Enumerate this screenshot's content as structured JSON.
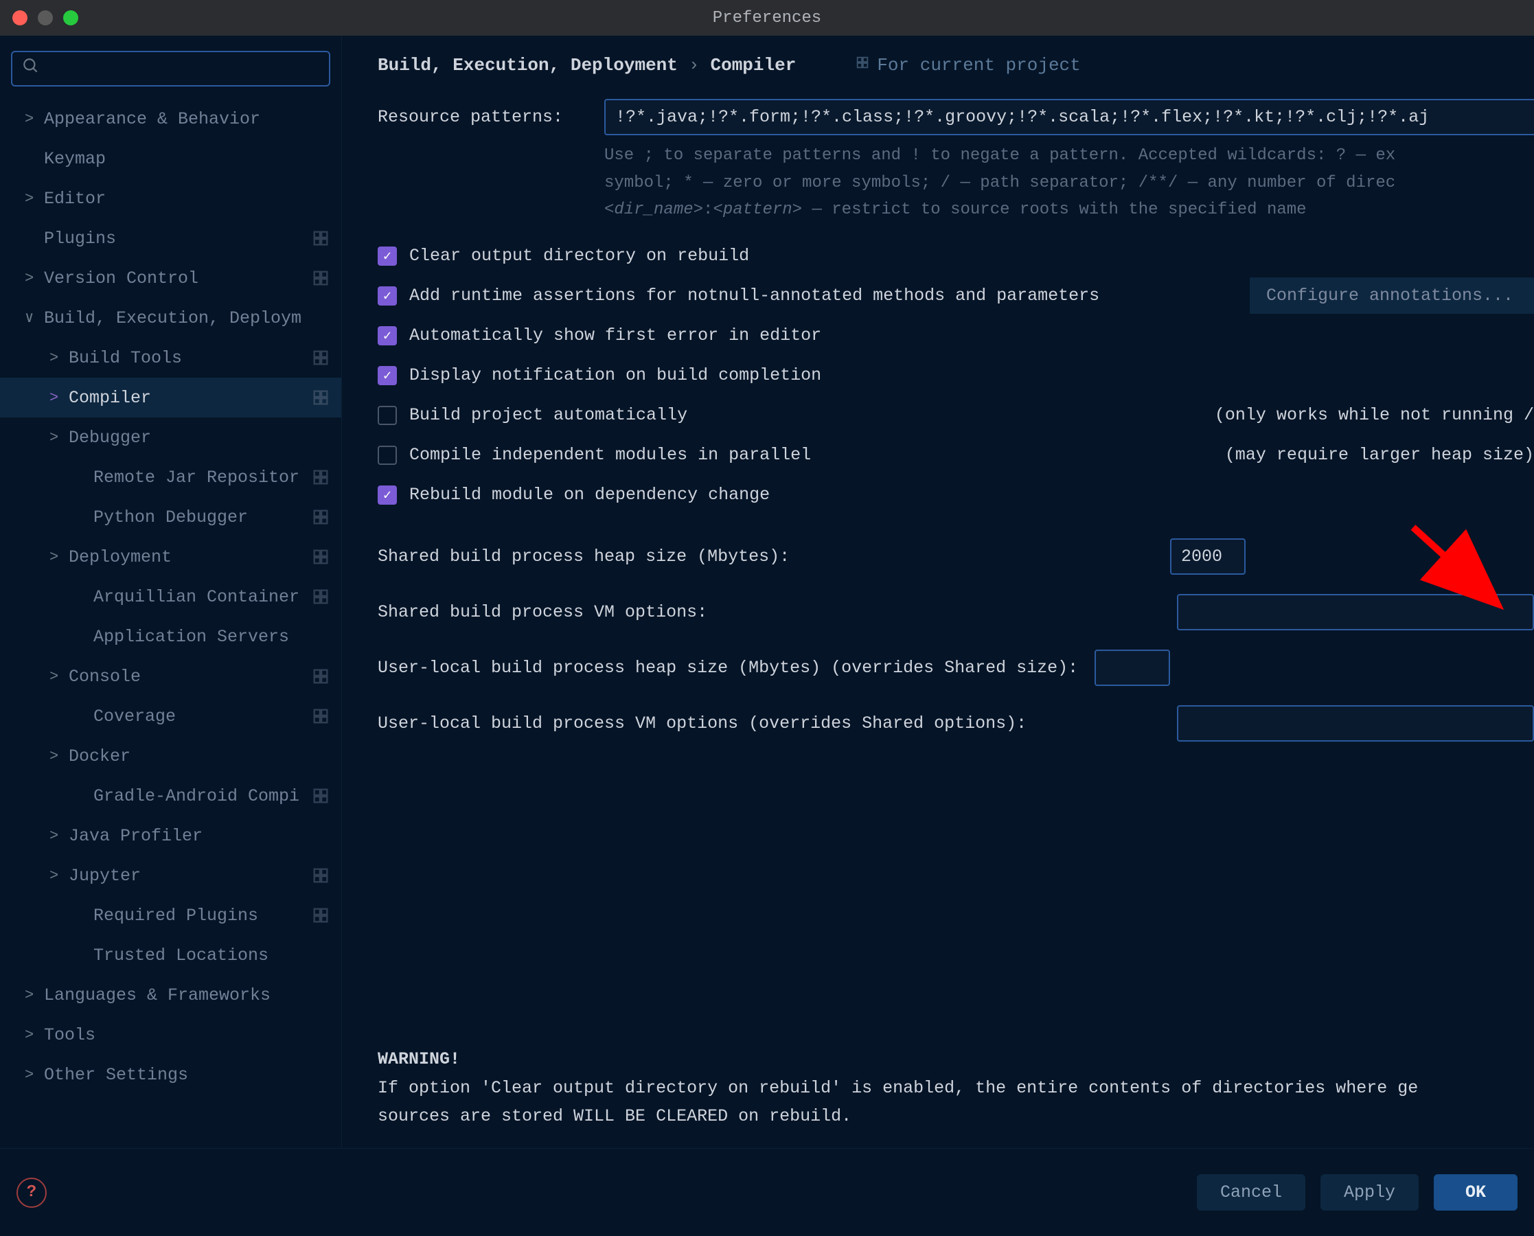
{
  "titlebar": {
    "title": "Preferences"
  },
  "search": {
    "placeholder": ""
  },
  "sidebar": {
    "items": [
      {
        "label": "Appearance & Behavior",
        "chevron": "right",
        "level": 0,
        "badge": false
      },
      {
        "label": "Keymap",
        "chevron": "none",
        "level": 0,
        "badge": false
      },
      {
        "label": "Editor",
        "chevron": "right",
        "level": 0,
        "badge": false
      },
      {
        "label": "Plugins",
        "chevron": "none",
        "level": 0,
        "badge": true
      },
      {
        "label": "Version Control",
        "chevron": "right",
        "level": 0,
        "badge": true
      },
      {
        "label": "Build, Execution, Deploym",
        "chevron": "down",
        "level": 0,
        "badge": false
      },
      {
        "label": "Build Tools",
        "chevron": "right",
        "level": 1,
        "badge": true
      },
      {
        "label": "Compiler",
        "chevron": "right",
        "level": 1,
        "badge": true,
        "selected": true
      },
      {
        "label": "Debugger",
        "chevron": "right",
        "level": 1,
        "badge": false
      },
      {
        "label": "Remote Jar Repositor",
        "chevron": "none",
        "level": 2,
        "badge": true
      },
      {
        "label": "Python Debugger",
        "chevron": "none",
        "level": 2,
        "badge": true
      },
      {
        "label": "Deployment",
        "chevron": "right",
        "level": 1,
        "badge": true
      },
      {
        "label": "Arquillian Container",
        "chevron": "none",
        "level": 2,
        "badge": true
      },
      {
        "label": "Application Servers",
        "chevron": "none",
        "level": 2,
        "badge": false
      },
      {
        "label": "Console",
        "chevron": "right",
        "level": 1,
        "badge": true
      },
      {
        "label": "Coverage",
        "chevron": "none",
        "level": 2,
        "badge": true
      },
      {
        "label": "Docker",
        "chevron": "right",
        "level": 1,
        "badge": false
      },
      {
        "label": "Gradle-Android Compi",
        "chevron": "none",
        "level": 2,
        "badge": true
      },
      {
        "label": "Java Profiler",
        "chevron": "right",
        "level": 1,
        "badge": false
      },
      {
        "label": "Jupyter",
        "chevron": "right",
        "level": 1,
        "badge": true
      },
      {
        "label": "Required Plugins",
        "chevron": "none",
        "level": 2,
        "badge": true
      },
      {
        "label": "Trusted Locations",
        "chevron": "none",
        "level": 2,
        "badge": false
      },
      {
        "label": "Languages & Frameworks",
        "chevron": "right",
        "level": 0,
        "badge": false
      },
      {
        "label": "Tools",
        "chevron": "right",
        "level": 0,
        "badge": false
      },
      {
        "label": "Other Settings",
        "chevron": "right",
        "level": 0,
        "badge": false
      }
    ]
  },
  "breadcrumb": {
    "root": "Build, Execution, Deployment",
    "sep": "›",
    "leaf": "Compiler",
    "scope": "For current project"
  },
  "form": {
    "resource_patterns_label": "Resource patterns:",
    "resource_patterns_value": "!?*.java;!?*.form;!?*.class;!?*.groovy;!?*.scala;!?*.flex;!?*.kt;!?*.clj;!?*.aj",
    "hint_line1": "Use ; to separate patterns and ! to negate a pattern. Accepted wildcards: ? — ex",
    "hint_line2": "symbol; * — zero or more symbols; / — path separator; /**/ — any number of direc",
    "hint_line3_pre": "",
    "hint_line3_i1": "<dir_name>",
    "hint_line3_mid": ":",
    "hint_line3_i2": "<pattern>",
    "hint_line3_post": " — restrict to source roots with the specified name",
    "checkboxes": [
      {
        "label": "Clear output directory on rebuild",
        "checked": true
      },
      {
        "label": "Add runtime assertions for notnull-annotated methods and parameters",
        "checked": true,
        "button": "Configure annotations..."
      },
      {
        "label": "Automatically show first error in editor",
        "checked": true
      },
      {
        "label": "Display notification on build completion",
        "checked": true
      },
      {
        "label": "Build project automatically",
        "checked": false,
        "aside": "(only works while not running /"
      },
      {
        "label": "Compile independent modules in parallel",
        "checked": false,
        "aside": "(may require larger heap size)"
      },
      {
        "label": "Rebuild module on dependency change",
        "checked": true
      }
    ],
    "heap_shared_label": "Shared build process heap size (Mbytes):",
    "heap_shared_value": "2000",
    "vm_shared_label": "Shared build process VM options:",
    "vm_shared_value": "",
    "heap_user_label": "User-local build process heap size (Mbytes) (overrides Shared size):",
    "heap_user_value": "",
    "vm_user_label": "User-local build process VM options (overrides Shared options):",
    "vm_user_value": ""
  },
  "warning": {
    "title": "WARNING!",
    "body": "If option 'Clear output directory on rebuild' is enabled, the entire contents of directories where ge\nsources are stored WILL BE CLEARED on rebuild."
  },
  "footer": {
    "cancel": "Cancel",
    "apply": "Apply",
    "ok": "OK"
  }
}
